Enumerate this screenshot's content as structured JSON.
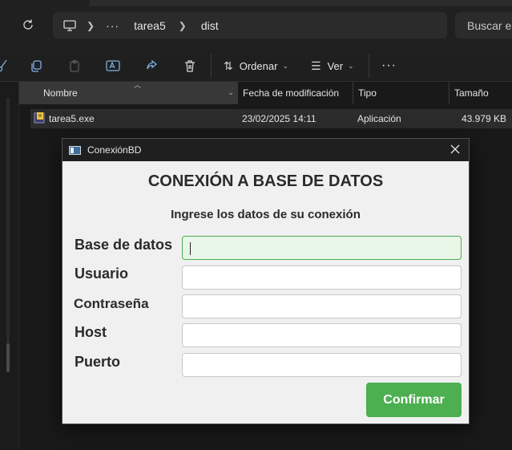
{
  "explorer": {
    "breadcrumb": [
      "tarea5",
      "dist"
    ],
    "more": "···",
    "search_placeholder": "Buscar en",
    "toolbar": {
      "sort_label": "Ordenar",
      "view_label": "Ver",
      "more_label": "···"
    },
    "columns": [
      "Nombre",
      "Fecha de modificación",
      "Tipo",
      "Tamaño"
    ],
    "files": [
      {
        "name": "tarea5.exe",
        "modified": "23/02/2025 14:11",
        "type": "Aplicación",
        "size": "43.979 KB"
      }
    ]
  },
  "dialog": {
    "title": "ConexiónBD",
    "heading": "CONEXIÓN A BASE DE DATOS",
    "subheading": "Ingrese los datos de su conexión",
    "fields": [
      {
        "label": "Base de datos",
        "value": ""
      },
      {
        "label": "Usuario",
        "value": ""
      },
      {
        "label": "Contraseña",
        "value": ""
      },
      {
        "label": "Host",
        "value": ""
      },
      {
        "label": "Puerto",
        "value": ""
      }
    ],
    "confirm_label": "Confirmar",
    "accent_color": "#4caf50"
  }
}
